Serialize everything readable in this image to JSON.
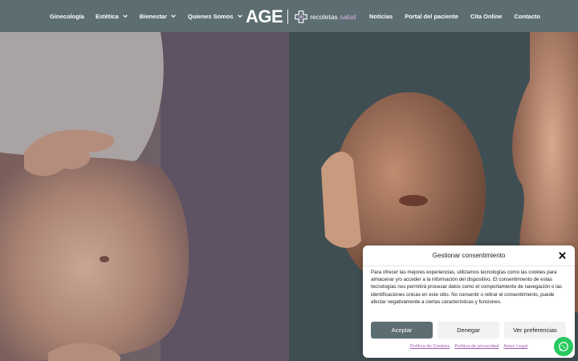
{
  "header": {
    "nav_left": [
      {
        "label": "Ginecología",
        "has_dropdown": false
      },
      {
        "label": "Estética",
        "has_dropdown": true
      },
      {
        "label": "Bienestar",
        "has_dropdown": true
      },
      {
        "label": "Quienes Somos",
        "has_dropdown": true
      }
    ],
    "logo": {
      "primary": "AGE",
      "brand": "recoletas",
      "brand_accent": "salud"
    },
    "nav_right": [
      {
        "label": "Noticias"
      },
      {
        "label": "Portal del paciente"
      },
      {
        "label": "Cita Online"
      },
      {
        "label": "Contacto"
      }
    ]
  },
  "consent": {
    "title": "Gestionar consentimiento",
    "body": "Para ofrecer las mejores experiencias, utilizamos tecnologías como las cookies para almacenar y/o acceder a la información del dispositivo. El consentimiento de estas tecnologías nos permitirá procesar datos como el comportamiento de navegación o las identificaciones únicas en este sitio. No consentir o retirar el consentimiento, puede afectar negativamente a ciertas características y funciones.",
    "accept_label": "Aceptar",
    "deny_label": "Denegar",
    "prefs_label": "Ver preferencias",
    "links": [
      "Política de Cookies",
      "Política de privacidad",
      "Aviso Legal"
    ]
  },
  "colors": {
    "header_bg": "#5d6e72",
    "accent": "#5d6e72",
    "link": "#a35fb6",
    "whatsapp": "#26c85f"
  },
  "icons": [
    "chevron-down-icon",
    "recoletas-cross-icon",
    "close-icon",
    "whatsapp-icon"
  ]
}
